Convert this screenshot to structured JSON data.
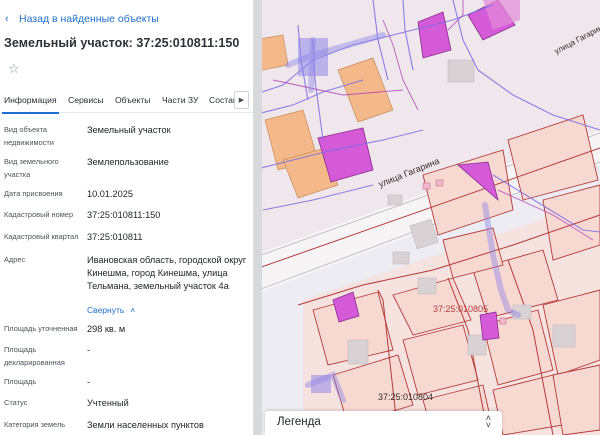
{
  "header": {
    "back_label": "Назад в найденные объекты",
    "title": "Земельный участок: 37:25:010811:150"
  },
  "tabs": [
    {
      "label": "Информация"
    },
    {
      "label": "Сервисы"
    },
    {
      "label": "Объекты"
    },
    {
      "label": "Части ЗУ"
    },
    {
      "label": "Состав"
    }
  ],
  "details": [
    {
      "label": "Вид объекта недвижимости",
      "value": "Земельный участок"
    },
    {
      "label": "Вид земельного участка",
      "value": "Землепользование"
    },
    {
      "label": "Дата присвоения",
      "value": "10.01.2025"
    },
    {
      "label": "Кадастровый номер",
      "value": "37:25:010811:150"
    },
    {
      "label": "Кадастровый квартал",
      "value": "37:25:010811"
    },
    {
      "label": "Адрес",
      "value": "Ивановская область, городской округ Кинешма, город Кинешма, улица Тельмана, земельный участок 4а"
    },
    {
      "label": "Площадь уточненная",
      "value": "298 кв. м"
    },
    {
      "label": "Площадь декларированная",
      "value": "-"
    },
    {
      "label": "Площадь",
      "value": "-"
    },
    {
      "label": "Статус",
      "value": "Учтенный"
    },
    {
      "label": "Категория земель",
      "value": "Земли населенных пунктов"
    }
  ],
  "collapse_label": "Свернуть",
  "map": {
    "street_label": "улица Гагарина",
    "street_label_top": "улица Гагарина",
    "quarter_labels": [
      "37:25:010805",
      "37:25:010804"
    ]
  },
  "legend": {
    "label": "Легенда"
  },
  "colors": {
    "accent": "#1e6fd0",
    "parcel_border": "#b23a3a",
    "parcel_fill": "#f7d9d2",
    "building_fill": "#f3b98a",
    "selected_fill": "#d45ad8",
    "network_line": "#7a6be6"
  }
}
